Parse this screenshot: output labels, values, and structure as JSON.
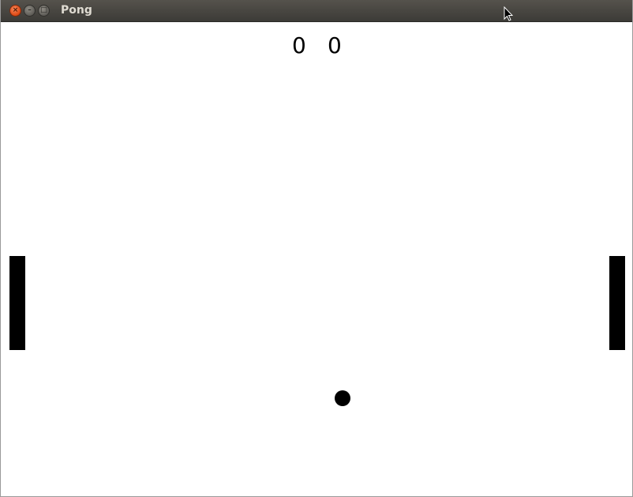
{
  "window": {
    "title": "Pong",
    "buttons": {
      "close_icon": "×",
      "minimize_icon": "–",
      "maximize_icon": "□"
    }
  },
  "game": {
    "score_left": "0",
    "score_right": "0",
    "colors": {
      "background": "#ffffff",
      "foreground": "#000000"
    }
  }
}
